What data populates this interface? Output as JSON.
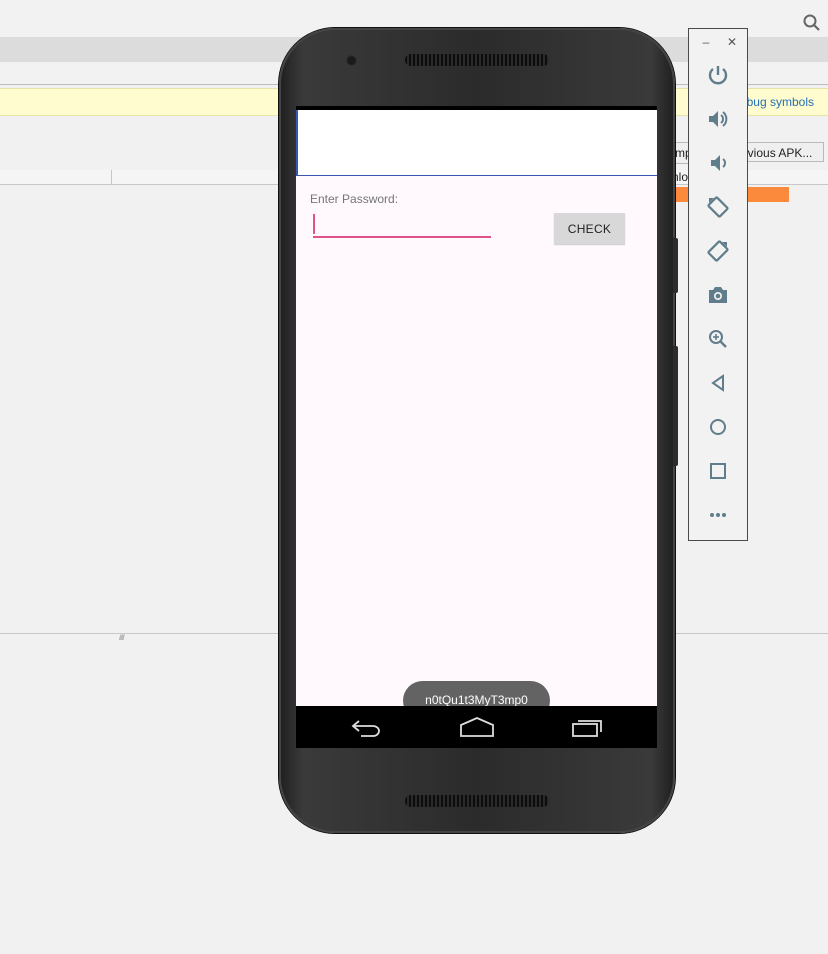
{
  "ide": {
    "notice_link": "bug symbols",
    "button_1": "mp",
    "button_2": "evious APK...",
    "row_text": "nlo"
  },
  "app": {
    "password_label": "Enter Password:",
    "password_value": "",
    "check_button": "CHECK",
    "toast_text": "n0tQu1t3MyT3mp0"
  },
  "emulator_toolbar": {
    "minimize": "–",
    "close": "✕",
    "icons": [
      "power-icon",
      "volume-up-icon",
      "volume-down-icon",
      "rotate-left-icon",
      "rotate-right-icon",
      "camera-icon",
      "zoom-icon",
      "back-icon",
      "home-icon",
      "overview-icon",
      "more-icon"
    ]
  },
  "colors": {
    "accent": "#e0538a",
    "appbar_border": "#3a56b3",
    "progress": "#fb8a3c",
    "notice_bg": "#fffccf"
  }
}
